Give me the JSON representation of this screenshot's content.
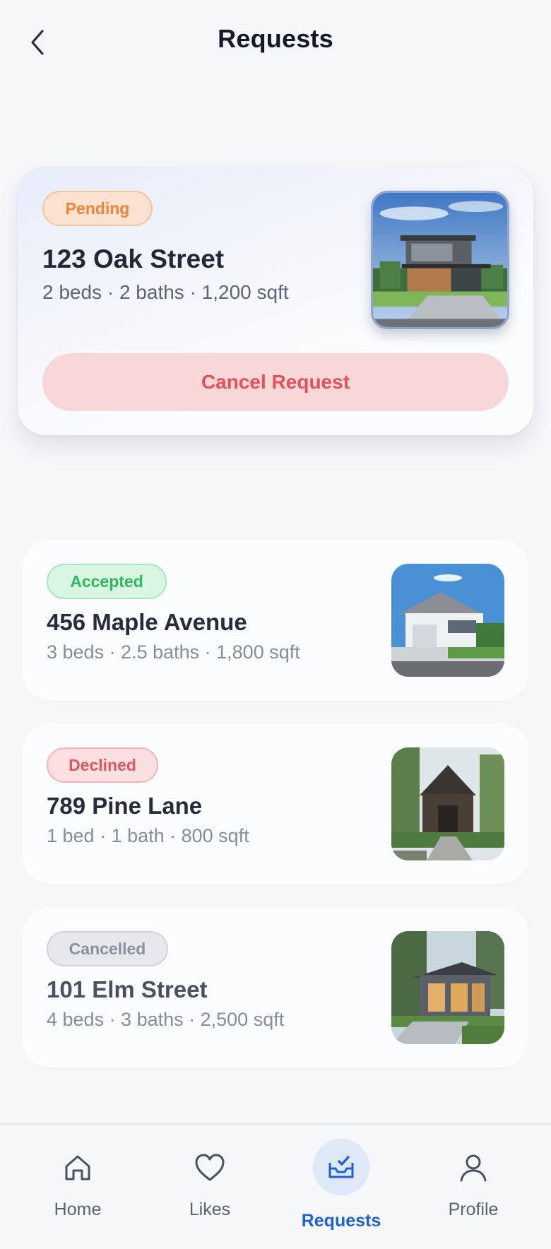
{
  "header": {
    "title": "Requests"
  },
  "featured": {
    "status": "Pending",
    "title": "123 Oak Street",
    "specs": "2 beds · 2 baths · 1,200 sqft",
    "cancel_label": "Cancel Request"
  },
  "requests": [
    {
      "status": "Accepted",
      "title": "456 Maple Avenue",
      "specs": "3 beds · 2.5 baths · 1,800 sqft"
    },
    {
      "status": "Declined",
      "title": "789 Pine Lane",
      "specs": "1 bed · 1 bath · 800 sqft"
    },
    {
      "status": "Cancelled",
      "title": "101 Elm Street",
      "specs": "4 beds · 3 baths · 2,500 sqft"
    }
  ],
  "nav": {
    "home": "Home",
    "likes": "Likes",
    "requests": "Requests",
    "profile": "Profile"
  },
  "colors": {
    "accent": "#1b63d4",
    "pending": "#ef8437",
    "accepted": "#2fb861",
    "declined": "#e0565d",
    "cancelled": "#8b909b"
  }
}
